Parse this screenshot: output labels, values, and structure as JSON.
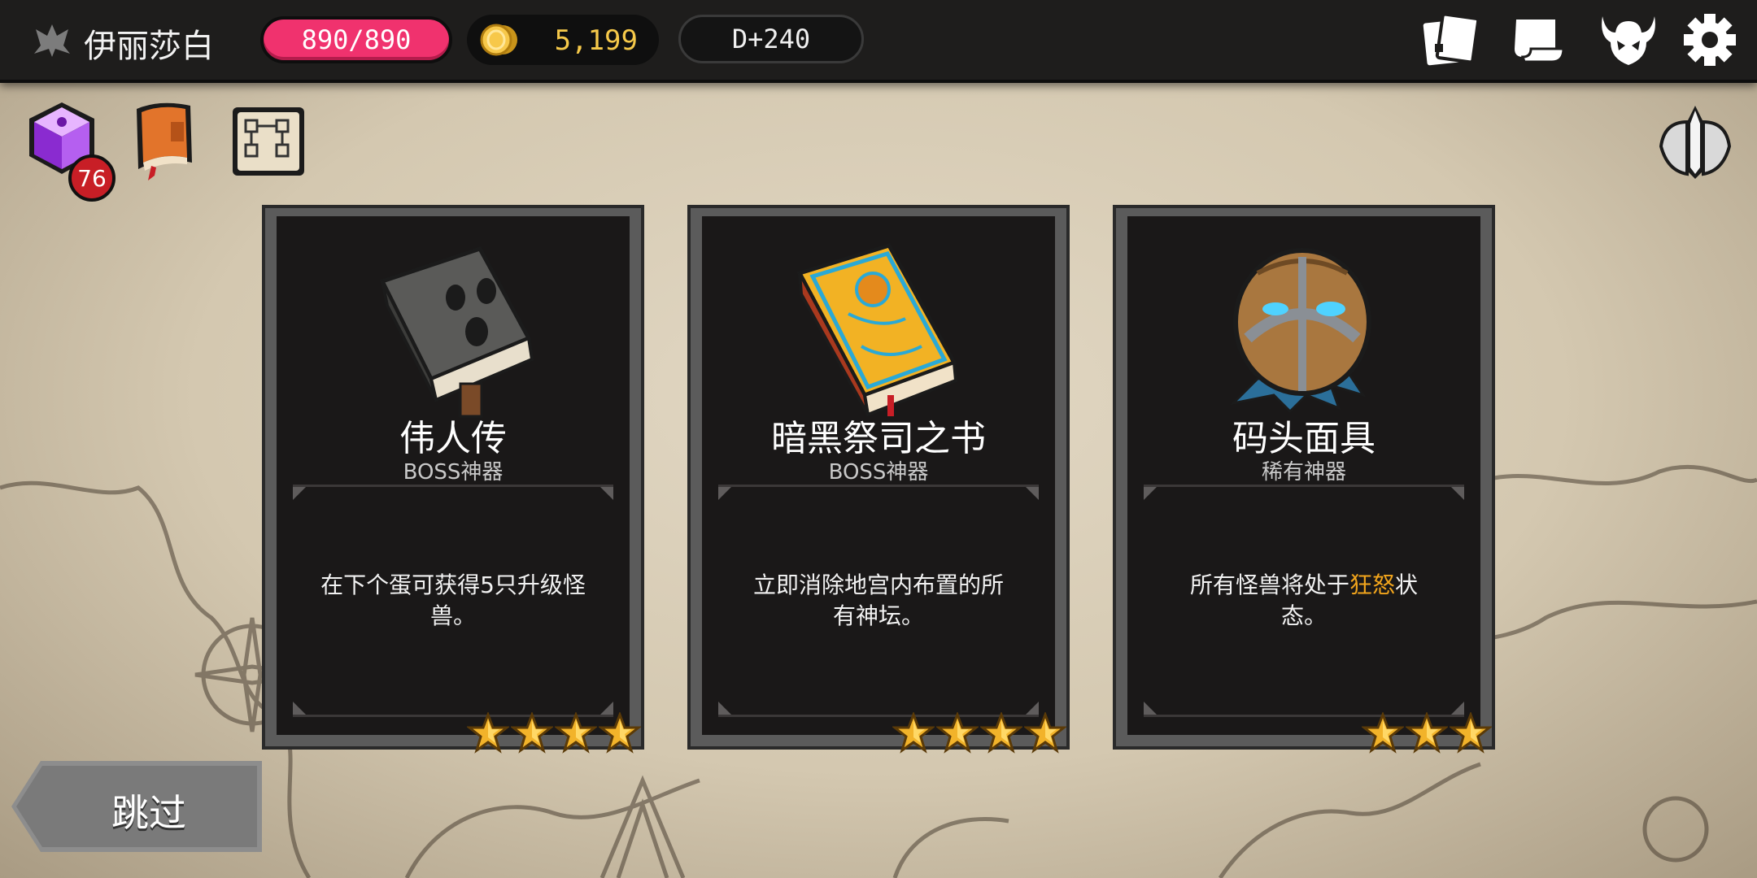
{
  "header": {
    "player_name": "伊丽莎白",
    "hp": "890/890",
    "gold": "5,199",
    "day": "D+240",
    "icons": [
      "cards-icon",
      "scroll-map-icon",
      "demon-skull-icon",
      "gear-icon"
    ]
  },
  "left_items": {
    "cube_badge": "76",
    "icons": [
      "purple-cube-icon",
      "orange-book-icon",
      "blueprint-scroll-icon"
    ]
  },
  "right_icon": "winged-emblem-icon",
  "cards": [
    {
      "title": "伟人传",
      "type": "BOSS神器",
      "desc": "在下个蛋可获得5只升级怪兽。",
      "desc_keyword": "",
      "desc_after": "",
      "stars": 4,
      "art": "stone-face-book-icon"
    },
    {
      "title": "暗黑祭司之书",
      "type": "BOSS神器",
      "desc": "立即消除地宫内布置的所有神坛。",
      "desc_keyword": "",
      "desc_after": "",
      "stars": 4,
      "art": "golden-book-icon"
    },
    {
      "title": "码头面具",
      "type": "稀有神器",
      "desc": "所有怪兽将处于",
      "desc_keyword": "狂怒",
      "desc_after": "状态。",
      "stars": 3,
      "art": "wooden-mask-icon"
    }
  ],
  "skip_label": "跳过",
  "colors": {
    "hp": "#f0326e",
    "gold_text": "#f6c94a",
    "keyword": "#f2a51c",
    "badge": "#c81e26"
  }
}
